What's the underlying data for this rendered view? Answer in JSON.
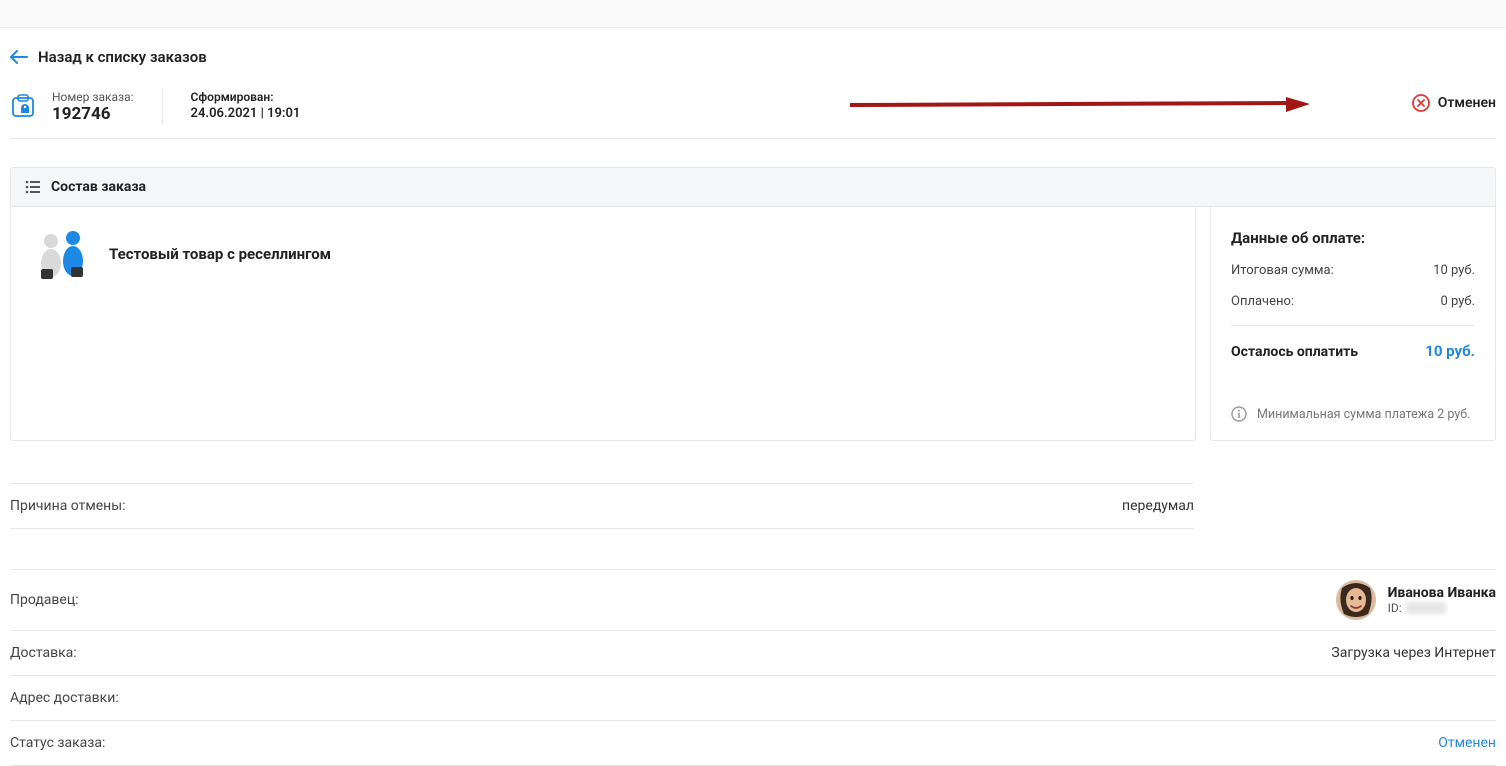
{
  "back_link": "Назад к списку заказов",
  "order": {
    "id_label": "Номер заказа:",
    "id_value": "192746",
    "formed_label": "Сформирован:",
    "formed_value": "24.06.2021 | 19:01",
    "status_text": "Отменен"
  },
  "composition": {
    "header": "Состав заказа",
    "product_title": "Тестовый товар с реселлингом"
  },
  "reason": {
    "label": "Причина отмены:",
    "value": "передумал"
  },
  "payment": {
    "title": "Данные об оплате:",
    "total_label": "Итоговая сумма:",
    "total_value": "10 руб.",
    "paid_label": "Оплачено:",
    "paid_value": "0 руб.",
    "remain_label": "Осталось оплатить",
    "remain_value": "10 руб.",
    "min_text": "Минимальная сумма платежа 2 руб."
  },
  "seller": {
    "label": "Продавец:",
    "name": "Иванова Иванка",
    "id_prefix": "ID:"
  },
  "delivery": {
    "label": "Доставка:",
    "value": "Загрузка через Интернет"
  },
  "address": {
    "label": "Адрес доставки:"
  },
  "order_status_row": {
    "label": "Статус заказа:",
    "value": "Отменен"
  }
}
